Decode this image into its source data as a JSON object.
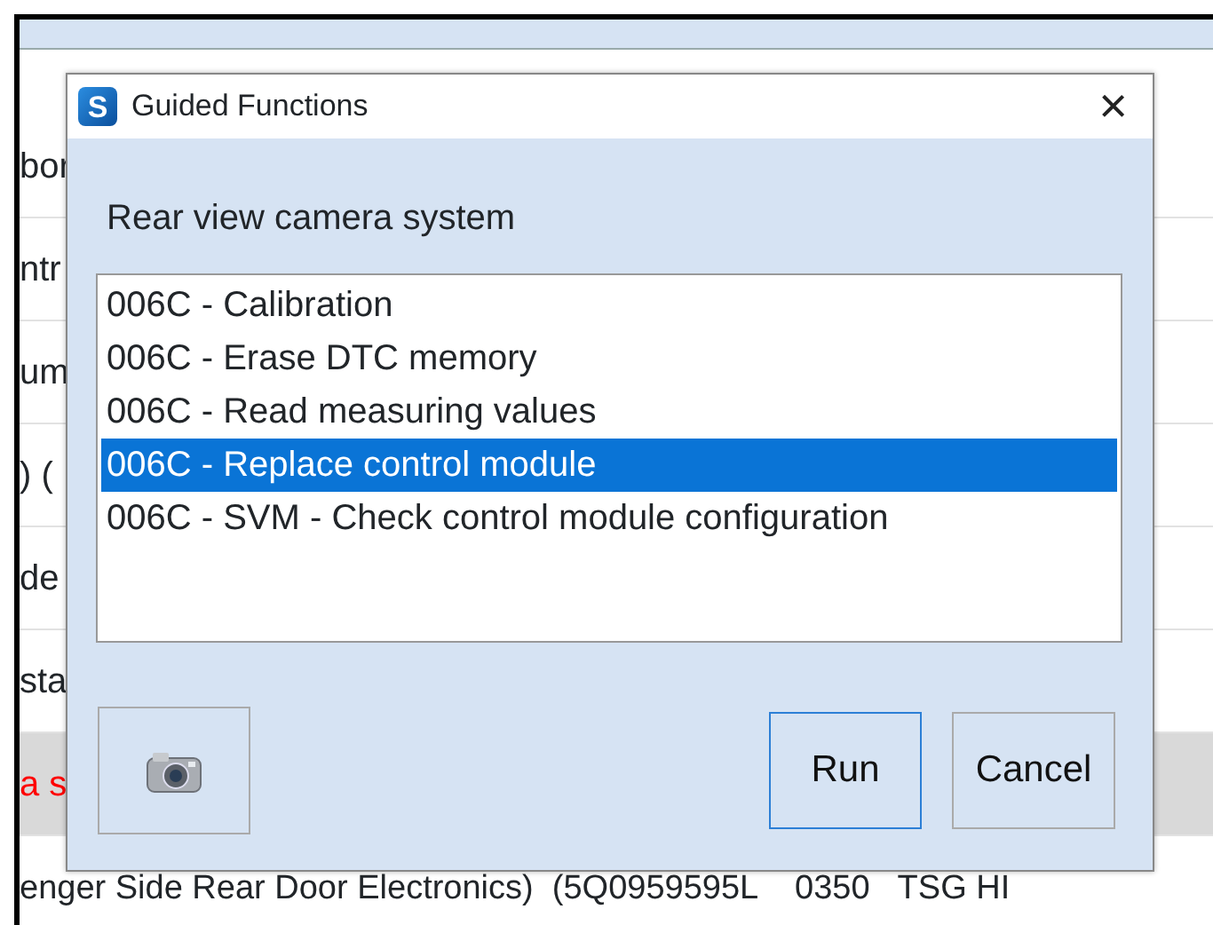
{
  "background_rows": [
    {
      "text": "bor",
      "highlighted": false
    },
    {
      "text": "ntr",
      "highlighted": false
    },
    {
      "text": "um",
      "highlighted": false
    },
    {
      "text": ") (",
      "highlighted": false
    },
    {
      "text": "de",
      "highlighted": false
    },
    {
      "text": "sta",
      "highlighted": false
    },
    {
      "text": "a s",
      "highlighted": true
    }
  ],
  "background_footer": "enger Side Rear Door Electronics)  (5Q0959595L    0350   TSG HI",
  "dialog": {
    "app_icon_letter": "S",
    "title": "Guided Functions",
    "close": "×",
    "heading": "Rear view camera system",
    "items": [
      {
        "label": "006C - Calibration",
        "selected": false
      },
      {
        "label": "006C - Erase DTC memory",
        "selected": false
      },
      {
        "label": "006C - Read measuring values",
        "selected": false
      },
      {
        "label": "006C - Replace control module",
        "selected": true
      },
      {
        "label": "006C - SVM - Check control module configuration",
        "selected": false
      }
    ],
    "buttons": [
      {
        "kind": "camera"
      },
      {
        "kind": "text",
        "label": "Run",
        "default": true
      },
      {
        "kind": "text",
        "label": "Cancel",
        "default": false
      }
    ]
  }
}
